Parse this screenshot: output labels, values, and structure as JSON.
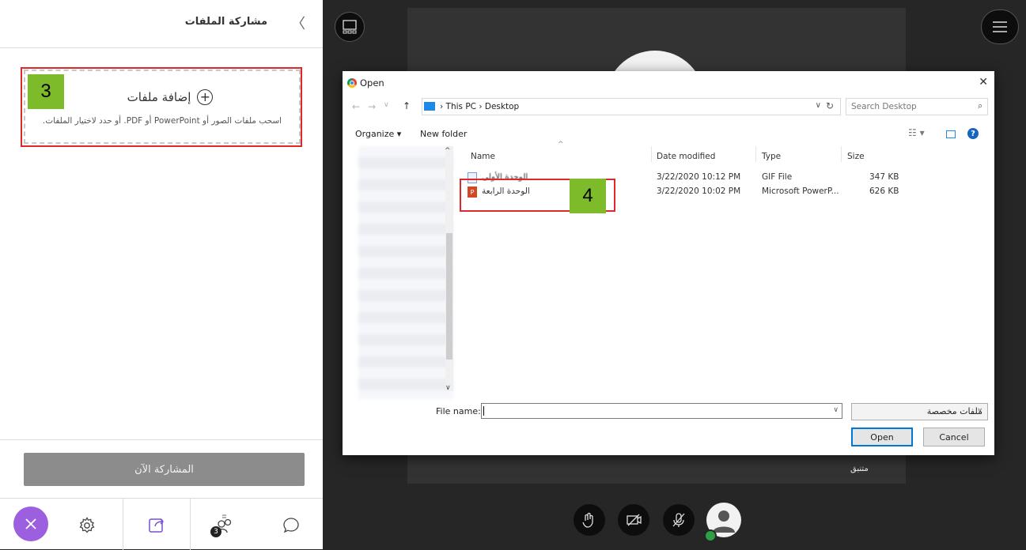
{
  "left_panel": {
    "title": "مشاركة الملفات",
    "add_files_title": "إضافة ملفات",
    "add_files_subtitle": "اسحب ملفات الصور أو PowerPoint أو PDF. أو حدد لاختيار الملفات.",
    "share_now_label": "المشاركة الآن",
    "step_badge": "3",
    "participants_count": "3"
  },
  "dialog": {
    "title": "Open",
    "path": [
      "This PC",
      "Desktop"
    ],
    "search_placeholder": "Search Desktop",
    "toolbar": {
      "organize": "Organize ▾",
      "new_folder": "New folder"
    },
    "columns": [
      "Name",
      "Date modified",
      "Type",
      "Size"
    ],
    "files": [
      {
        "name": "الوحدة الأولى",
        "date": "3/22/2020 10:12 PM",
        "type": "GIF File",
        "size": "347 KB"
      },
      {
        "name": "الوحدة الرابعة",
        "date": "3/22/2020 10:02 PM",
        "type": "Microsoft PowerP...",
        "size": "626 KB"
      }
    ],
    "file_name_label": "File name:",
    "file_name_value": "",
    "filter": "ملفات مخصصة",
    "open_label": "Open",
    "cancel_label": "Cancel",
    "step_badge": "4"
  },
  "stage": {
    "speaker_label": "متنبق"
  },
  "colors": {
    "accent_purple": "#9c5fe0",
    "highlight_red": "#e1272a",
    "badge_green": "#7dbb2a",
    "windows_blue": "#0078d7"
  }
}
